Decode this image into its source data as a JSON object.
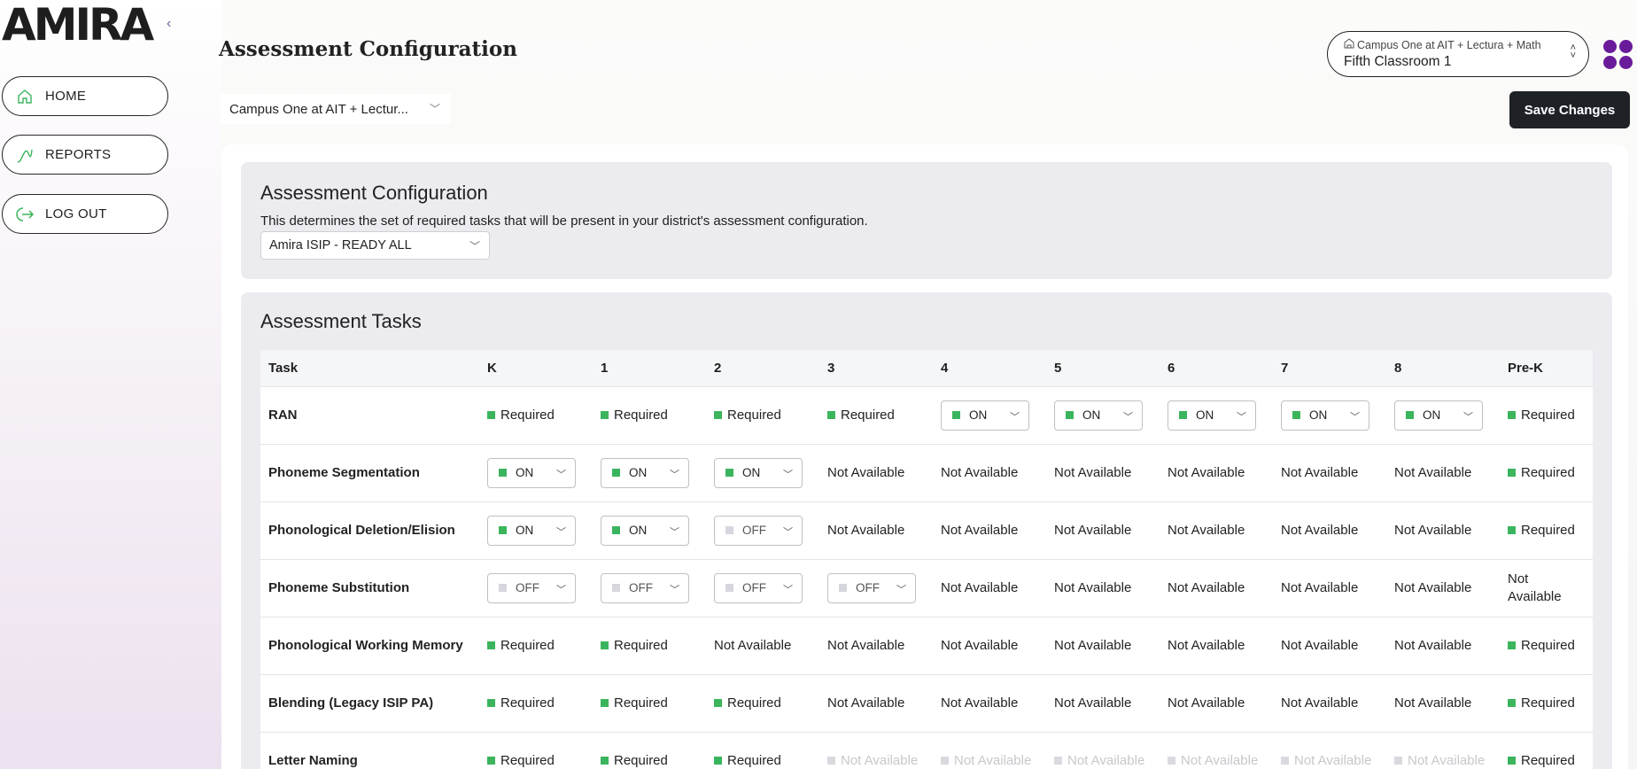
{
  "sidebar": {
    "logo": "AMIRA",
    "nav": [
      {
        "label": "HOME"
      },
      {
        "label": "REPORTS"
      },
      {
        "label": "LOG OUT"
      }
    ]
  },
  "header": {
    "title": "Assessment Configuration",
    "campus_select": "Campus One at AIT + Lectur...",
    "class_picker": {
      "campus": "Campus One at AIT + Lectura + Math",
      "classroom": "Fifth Classroom 1"
    },
    "save_label": "Save Changes"
  },
  "config": {
    "title": "Assessment Configuration",
    "description": "This determines the set of required tasks that will be present in your district's assessment configuration.",
    "selected": "Amira ISIP - READY ALL"
  },
  "tasks": {
    "title": "Assessment Tasks",
    "columns": [
      "Task",
      "K",
      "1",
      "2",
      "3",
      "4",
      "5",
      "6",
      "7",
      "8",
      "Pre-K"
    ],
    "rows": [
      {
        "task": "RAN",
        "cells": [
          {
            "t": "req",
            "v": "Required"
          },
          {
            "t": "req",
            "v": "Required"
          },
          {
            "t": "req",
            "v": "Required"
          },
          {
            "t": "req",
            "v": "Required"
          },
          {
            "t": "on",
            "v": "ON"
          },
          {
            "t": "on",
            "v": "ON"
          },
          {
            "t": "on",
            "v": "ON"
          },
          {
            "t": "on",
            "v": "ON"
          },
          {
            "t": "on",
            "v": "ON"
          },
          {
            "t": "req",
            "v": "Required"
          }
        ]
      },
      {
        "task": "Phoneme Segmentation",
        "cells": [
          {
            "t": "on",
            "v": "ON"
          },
          {
            "t": "on",
            "v": "ON"
          },
          {
            "t": "on",
            "v": "ON"
          },
          {
            "t": "na",
            "v": "Not Available"
          },
          {
            "t": "na",
            "v": "Not Available"
          },
          {
            "t": "na",
            "v": "Not Available"
          },
          {
            "t": "na",
            "v": "Not Available"
          },
          {
            "t": "na",
            "v": "Not Available"
          },
          {
            "t": "na",
            "v": "Not Available"
          },
          {
            "t": "req",
            "v": "Required"
          }
        ]
      },
      {
        "task": "Phonological Deletion/Elision",
        "cells": [
          {
            "t": "on",
            "v": "ON"
          },
          {
            "t": "on",
            "v": "ON"
          },
          {
            "t": "off",
            "v": "OFF"
          },
          {
            "t": "na",
            "v": "Not Available"
          },
          {
            "t": "na",
            "v": "Not Available"
          },
          {
            "t": "na",
            "v": "Not Available"
          },
          {
            "t": "na",
            "v": "Not Available"
          },
          {
            "t": "na",
            "v": "Not Available"
          },
          {
            "t": "na",
            "v": "Not Available"
          },
          {
            "t": "req",
            "v": "Required"
          }
        ]
      },
      {
        "task": "Phoneme Substitution",
        "cells": [
          {
            "t": "off",
            "v": "OFF"
          },
          {
            "t": "off",
            "v": "OFF"
          },
          {
            "t": "off",
            "v": "OFF"
          },
          {
            "t": "off",
            "v": "OFF"
          },
          {
            "t": "na",
            "v": "Not Available"
          },
          {
            "t": "na",
            "v": "Not Available"
          },
          {
            "t": "na",
            "v": "Not Available"
          },
          {
            "t": "na",
            "v": "Not Available"
          },
          {
            "t": "na",
            "v": "Not Available"
          },
          {
            "t": "na2",
            "v": "Not Available"
          }
        ]
      },
      {
        "task": "Phonological Working Memory",
        "cells": [
          {
            "t": "req",
            "v": "Required"
          },
          {
            "t": "req",
            "v": "Required"
          },
          {
            "t": "na",
            "v": "Not Available"
          },
          {
            "t": "na",
            "v": "Not Available"
          },
          {
            "t": "na",
            "v": "Not Available"
          },
          {
            "t": "na",
            "v": "Not Available"
          },
          {
            "t": "na",
            "v": "Not Available"
          },
          {
            "t": "na",
            "v": "Not Available"
          },
          {
            "t": "na",
            "v": "Not Available"
          },
          {
            "t": "req",
            "v": "Required"
          }
        ]
      },
      {
        "task": "Blending (Legacy ISIP PA)",
        "cells": [
          {
            "t": "req",
            "v": "Required"
          },
          {
            "t": "req",
            "v": "Required"
          },
          {
            "t": "req",
            "v": "Required"
          },
          {
            "t": "na",
            "v": "Not Available"
          },
          {
            "t": "na",
            "v": "Not Available"
          },
          {
            "t": "na",
            "v": "Not Available"
          },
          {
            "t": "na",
            "v": "Not Available"
          },
          {
            "t": "na",
            "v": "Not Available"
          },
          {
            "t": "na",
            "v": "Not Available"
          },
          {
            "t": "req",
            "v": "Required"
          }
        ]
      },
      {
        "task": "Letter Naming",
        "cells": [
          {
            "t": "req",
            "v": "Required"
          },
          {
            "t": "req",
            "v": "Required"
          },
          {
            "t": "req",
            "v": "Required"
          },
          {
            "t": "nadim",
            "v": "Not Available"
          },
          {
            "t": "nadim",
            "v": "Not Available"
          },
          {
            "t": "nadim",
            "v": "Not Available"
          },
          {
            "t": "nadim",
            "v": "Not Available"
          },
          {
            "t": "nadim",
            "v": "Not Available"
          },
          {
            "t": "nadim",
            "v": "Not Available"
          },
          {
            "t": "req",
            "v": "Required"
          }
        ]
      }
    ]
  },
  "colors": {
    "accent_green": "#3bb55d",
    "brand_purple": "#6a1b9a",
    "save_button_bg": "#1e2227"
  }
}
